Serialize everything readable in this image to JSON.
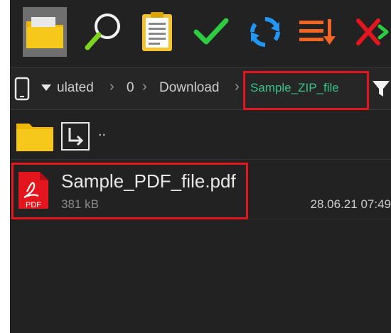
{
  "toolbar": {
    "buttons": [
      {
        "name": "folder-button",
        "icon": "folder-icon",
        "active": true
      },
      {
        "name": "search-button",
        "icon": "search-icon"
      },
      {
        "name": "clipboard-button",
        "icon": "clipboard-icon"
      },
      {
        "name": "select-button",
        "icon": "checkmark-icon"
      },
      {
        "name": "refresh-button",
        "icon": "refresh-icon"
      },
      {
        "name": "sort-button",
        "icon": "sort-icon"
      },
      {
        "name": "close-button",
        "icon": "close-icon"
      }
    ]
  },
  "pathbar": {
    "device_icon": "phone-icon",
    "crumbs": [
      "ulated",
      "0",
      "Download"
    ],
    "current": "Sample_ZIP_file",
    "filter_icon": "filter-icon"
  },
  "parent_row": {
    "label": ".."
  },
  "files": [
    {
      "name": "Sample_PDF_file.pdf",
      "size": "381 kB",
      "date": "28.06.21 07:49",
      "icon": "pdf-icon",
      "icon_label": "PDF"
    }
  ],
  "colors": {
    "highlight": "#e3161d",
    "current_crumb": "#36c48c",
    "background": "#222222"
  }
}
